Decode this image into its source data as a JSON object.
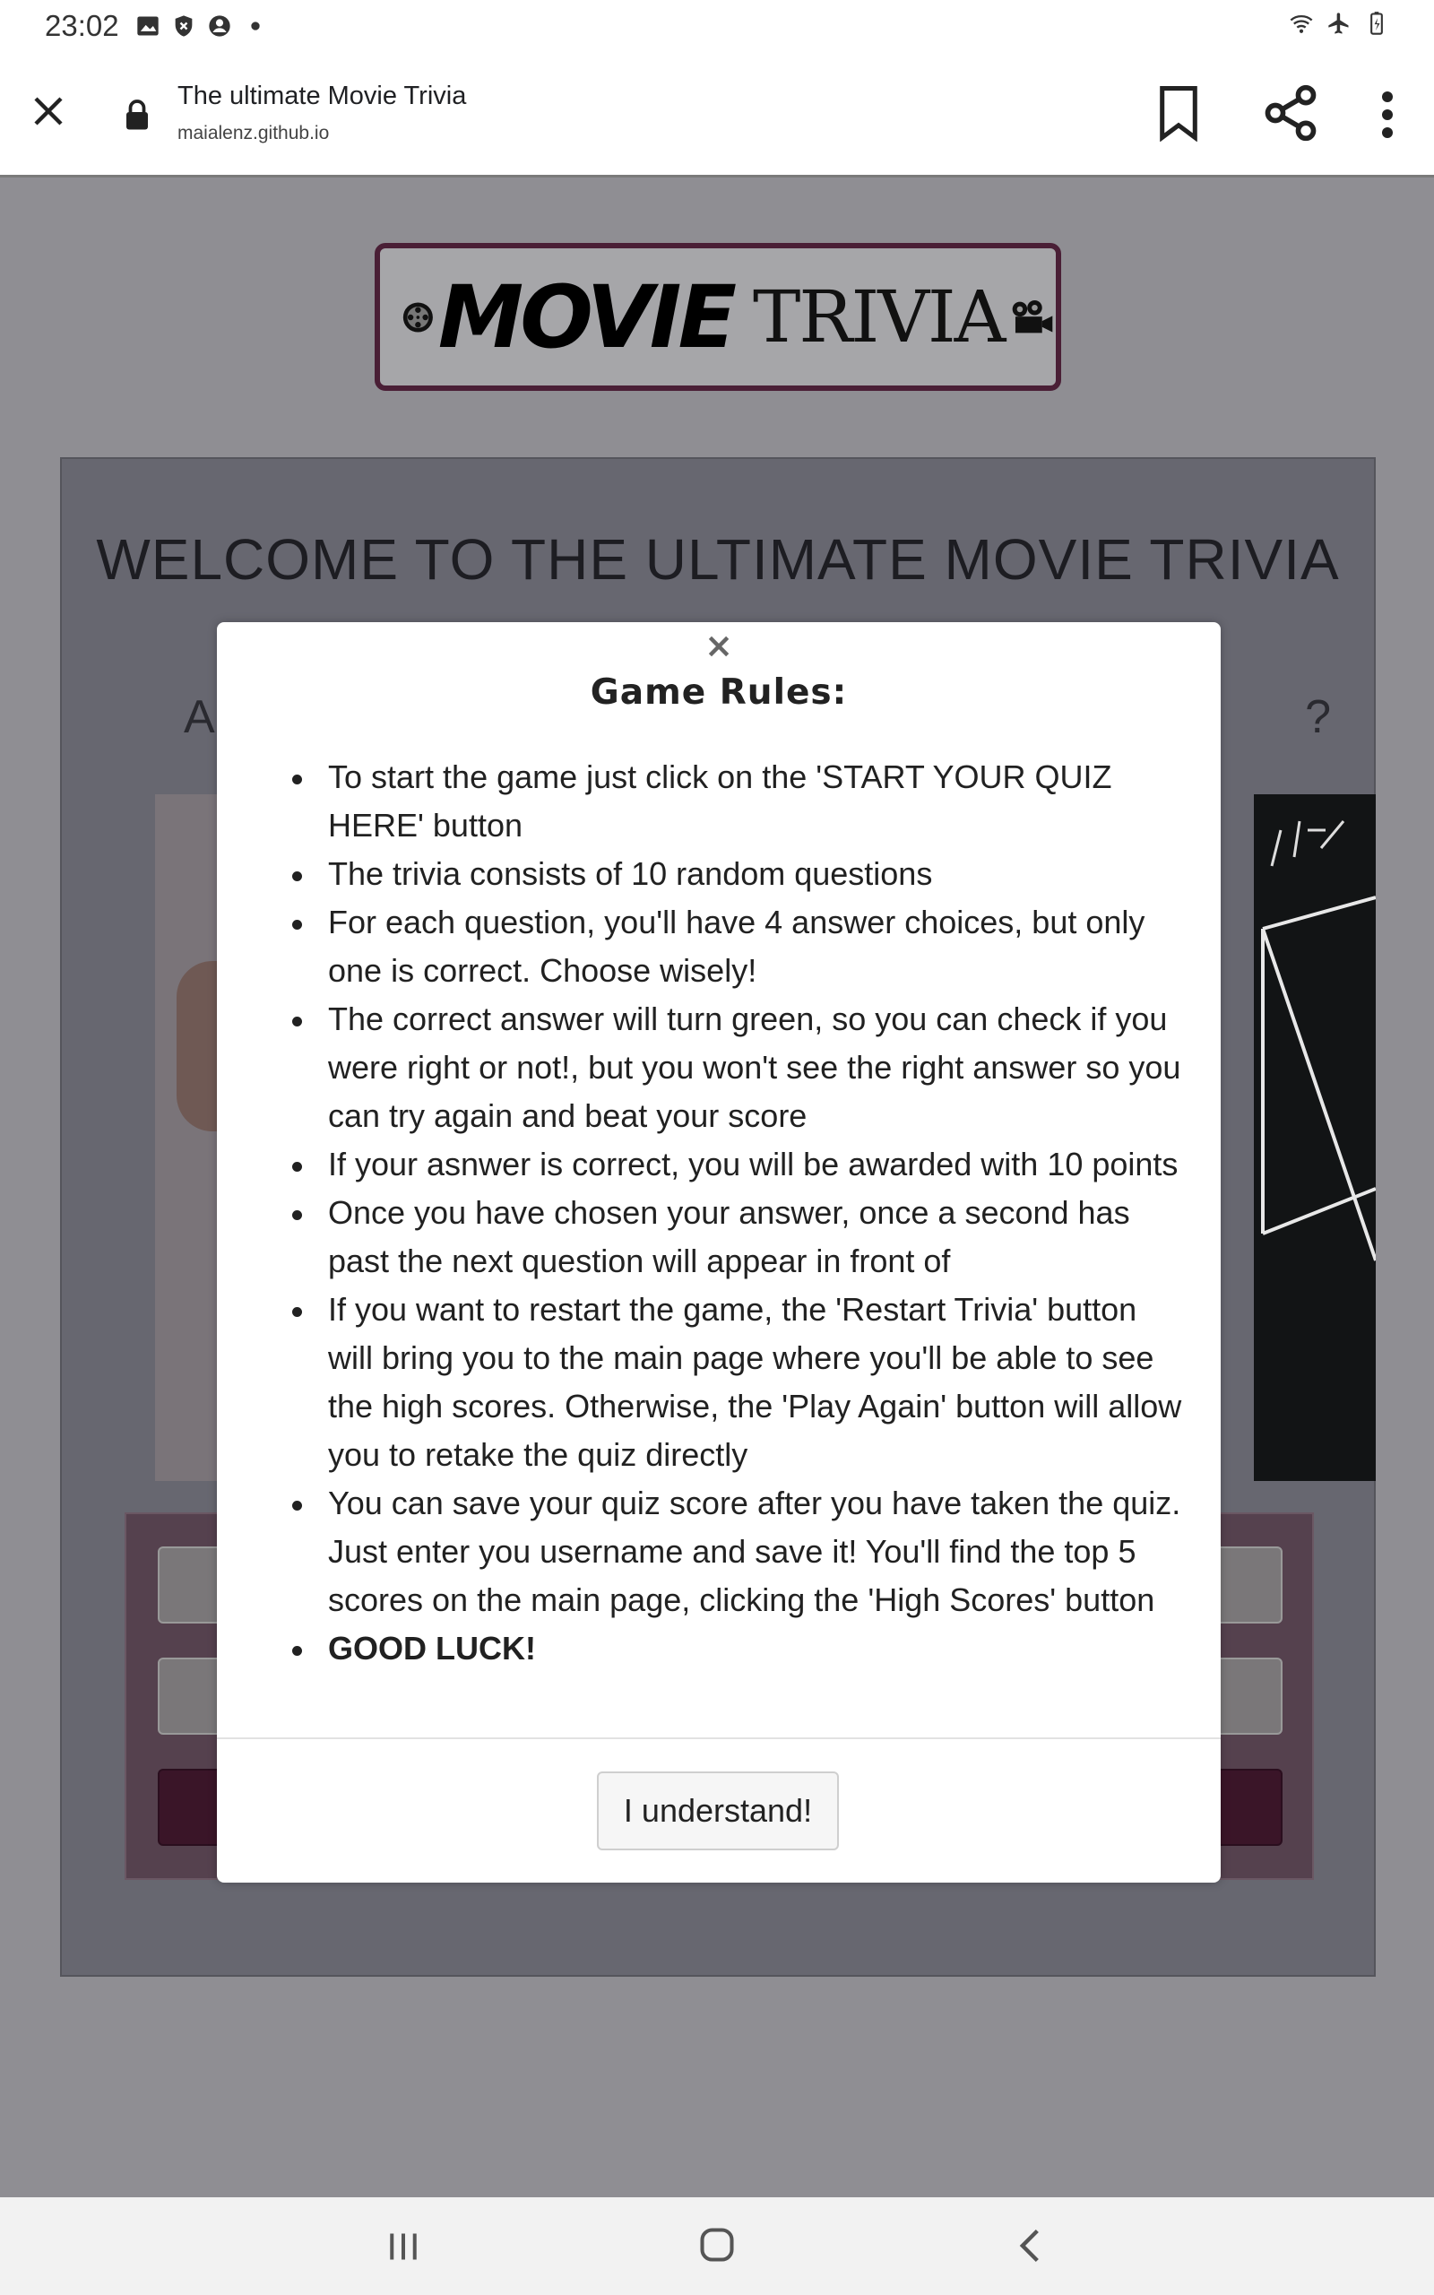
{
  "status_bar": {
    "time": "23:02",
    "left_icons": [
      "image-icon",
      "shield-icon",
      "account-icon",
      "dot-icon"
    ],
    "right_icons": [
      "wifi-icon",
      "airplane-icon",
      "battery-icon"
    ]
  },
  "browser": {
    "page_title": "The ultimate Movie Trivia",
    "url": "maialenz.github.io",
    "actions": [
      "close-icon",
      "bookmark-icon",
      "share-icon",
      "more-icon"
    ]
  },
  "page": {
    "logo_movie": "MOVIE",
    "logo_trivia": "TRIVIA",
    "welcome": "WELCOME TO THE ULTIMATE MOVIE TRIVIA",
    "subtitle_left": "A",
    "subtitle_right": "?"
  },
  "modal": {
    "close": "×",
    "title": "Game Rules:",
    "rules": [
      "To start the game just click on the 'START YOUR QUIZ HERE' button",
      "The trivia consists of 10 random questions",
      "For each question, you'll have 4 answer choices, but only one is correct. Choose wisely!",
      "The correct answer will turn green, so you can check if you were right or not!, but you won't see the right answer so you can try again and beat your score",
      "If your asnwer is correct, you will be awarded with 10 points",
      "Once you have chosen your answer, once a second has past the next question will appear in front of",
      "If you want to restart the game, the 'Restart Trivia' button will bring you to the main page where you'll be able to see the high scores. Otherwise, the 'Play Again' button will allow you to retake the quiz directly",
      "You can save your quiz score after you have taken the quiz. Just enter you username and save it! You'll find the top 5 scores on the main page, clicking the 'High Scores' button",
      "GOOD LUCK!"
    ],
    "confirm_button": "I understand!"
  },
  "nav_bar": {
    "buttons": [
      "recent-apps-icon",
      "home-icon",
      "back-icon"
    ]
  },
  "colors": {
    "accent": "#4a1f36",
    "overlay_bg": "#8f8e93",
    "modal_bg": "#ffffff"
  }
}
